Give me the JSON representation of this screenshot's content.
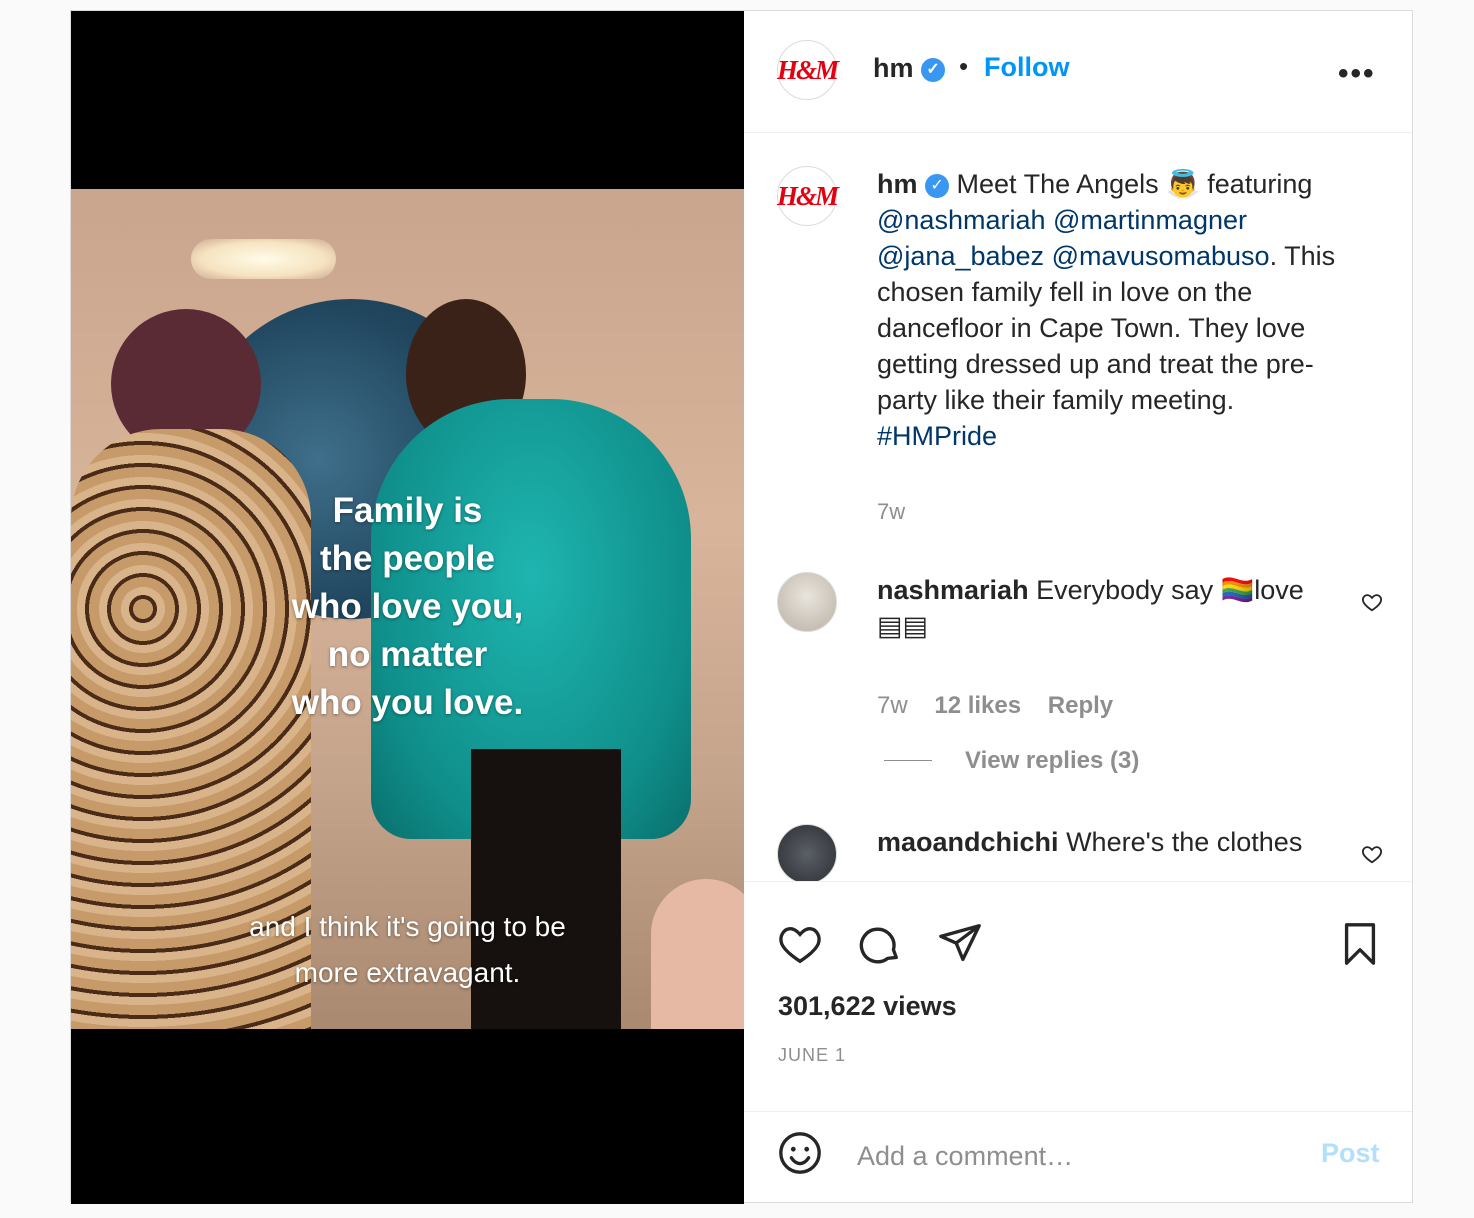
{
  "post": {
    "username": "hm",
    "follow_label": "Follow",
    "separator": "•",
    "more_label": "•••",
    "logo_text": "H&M"
  },
  "media": {
    "overlay_lines": [
      "Family is",
      "the people",
      "who love you,",
      "no matter",
      "who you love."
    ],
    "subtitle_lines": [
      "and I think it's going to be",
      "more extravagant."
    ]
  },
  "caption": {
    "username": "hm",
    "text_before": "Meet The Angels 👼 featuring",
    "mentions": [
      "@nashmariah",
      "@martinmagner",
      "@jana_babez",
      "@mavusomabuso"
    ],
    "text_after": ". This chosen family fell in love on the dancefloor in Cape Town. They love getting dressed up and treat the pre-party like their family meeting.",
    "hashtag": "#HMPride",
    "time": "7w"
  },
  "comments": [
    {
      "username": "nashmariah",
      "text": "Everybody say 🏳️‍🌈love ▤▤",
      "time": "7w",
      "likes": "12 likes",
      "reply_label": "Reply",
      "view_replies": "View replies (3)"
    },
    {
      "username": "maoandchichi",
      "text": "Where's the clothes"
    }
  ],
  "stats": {
    "views": "301,622 views",
    "date": "JUNE 1"
  },
  "add_comment": {
    "placeholder": "Add a comment…",
    "post_label": "Post"
  },
  "colors": {
    "accent": "#0095f6",
    "brand": "#e50010",
    "link": "#00376b",
    "muted": "#8e8e8e"
  }
}
